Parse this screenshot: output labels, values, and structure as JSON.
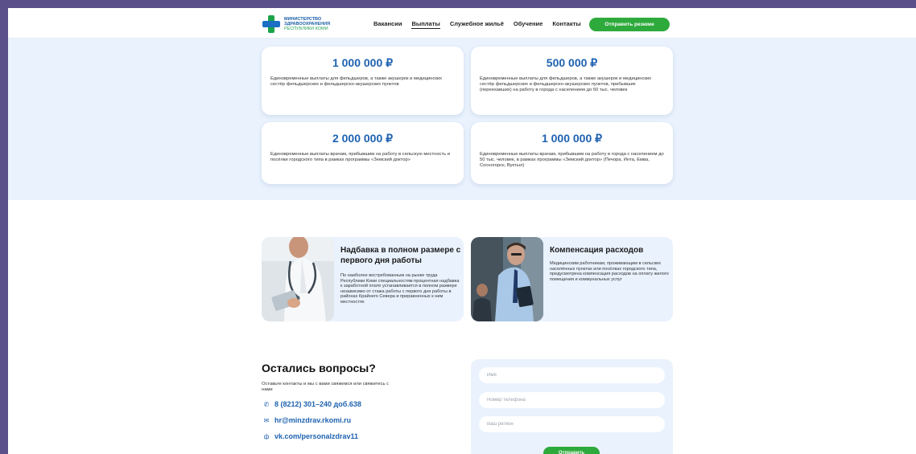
{
  "header": {
    "logo_line1": "МИНИСТЕРСТВО",
    "logo_line2": "ЗДРАВООХРАНЕНИЯ",
    "logo_line3": "РЕСПУБЛИКИ КОМИ",
    "nav": [
      "Вакансии",
      "Выплаты",
      "Служебное жильё",
      "Обучение",
      "Контакты"
    ],
    "active_nav": "Выплаты",
    "cta_label": "Отправить резюме"
  },
  "payouts": [
    {
      "amount": "1 000 000 ₽",
      "text": "Единовременные выплаты для фельдшеров, а также акушерок и медицинских сестёр фельдшерских и фельдшерско-акушерских пунктов"
    },
    {
      "amount": "500 000 ₽",
      "text": "Единовременные выплаты для фельдшеров, а также акушерок и медицинских сестёр фельдшерских и фельдшерско-акушерских пунктов, прибывших (переехавших) на работу в города с населением до 50 тыс. человек"
    },
    {
      "amount": "2 000 000 ₽",
      "text": "Единовременные выплаты врачам, прибывшим на работу в сельскую местность и посёлки городского типа в рамках программы «Земский доктор»"
    },
    {
      "amount": "1 000 000 ₽",
      "text": "Единовременные выплаты врачам, прибывшим на работу в города с населением до 50 тыс. человек, в рамках программы «Земский доктор» (Печора, Инта, Емва, Сосногорск, Вуктыл)"
    }
  ],
  "benefits": [
    {
      "title": "Надбавка в полном размере с первого дня работы",
      "text": "По наиболее востребованным на рынке труда Республики Коми специальностям процентная надбавка к заработной плате устанавливается в полном размере независимо от стажа работы с первого дня работы в районах Крайнего Севера и приравненных к ним местностях"
    },
    {
      "title": "Компенсация расходов",
      "text": "Медицинским работникам, проживающим в сельских населённых пунктах или посёлках городского типа, предусмотрена компенсация расходов на оплату жилого помещения и коммунальных услуг"
    }
  ],
  "contacts": {
    "title": "Остались вопросы?",
    "subtitle": "Оставьте контакты и мы с вами свяжемся или свяжитесь с нами",
    "phone": "8 (8212) 301–240 доб.638",
    "email": "hr@minzdrav.rkomi.ru",
    "vk": "vk.com/personalzdrav11",
    "phone_icon": "phone-icon",
    "email_icon": "mail-icon",
    "vk_icon": "vk-icon"
  },
  "form": {
    "name_placeholder": "Имя",
    "phone_placeholder": "Номер телефона",
    "region_placeholder": "Ваш регион",
    "submit_label": "Отправить"
  },
  "colors": {
    "accent_blue": "#1e62b0",
    "accent_green": "#2eaa3c",
    "section_bg": "#e9f2fd"
  }
}
